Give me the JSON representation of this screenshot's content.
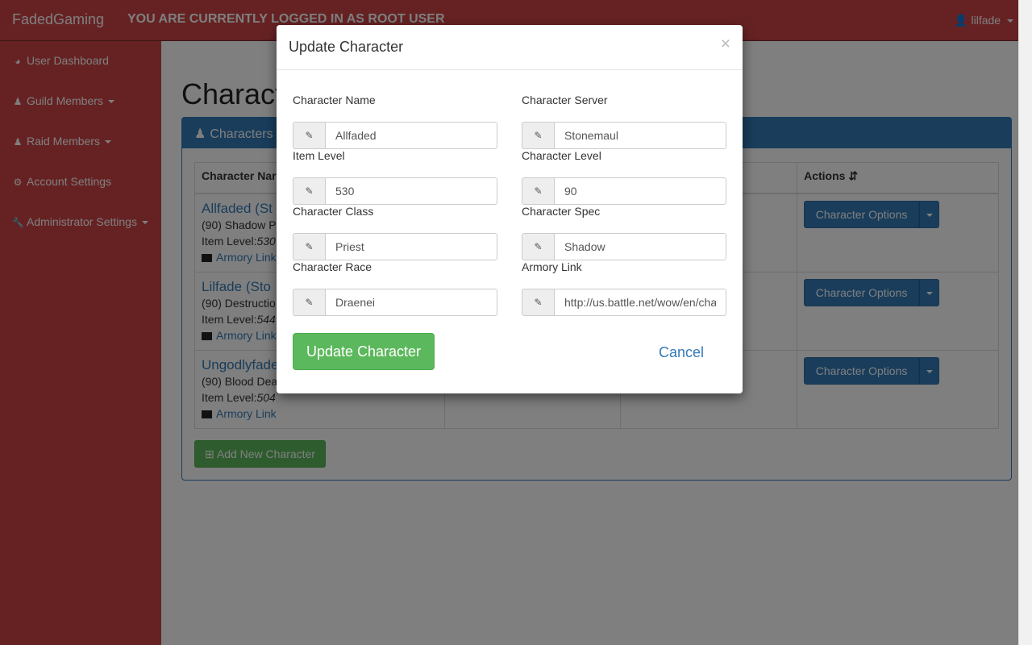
{
  "navbar": {
    "brand": "FadedGaming",
    "notice": "YOU ARE CURRENTLY LOGGED IN AS ROOT USER",
    "user": "lilfade",
    "user_icon": "user-icon"
  },
  "sidebar": {
    "items": [
      {
        "label": "User Dashboard",
        "icon": "dashboard-icon"
      },
      {
        "label": "Guild Members",
        "icon": "users-icon"
      },
      {
        "label": "Raid Members",
        "icon": "users-icon"
      },
      {
        "label": "Account Settings",
        "icon": "gear-icon"
      },
      {
        "label": "Administrator Settings",
        "icon": "wrench-icon"
      }
    ]
  },
  "main": {
    "title": "Charact",
    "panel_title": "Characters",
    "table": {
      "headers": [
        "Character Nar",
        "",
        "",
        "Actions"
      ],
      "rows": [
        {
          "name": "Allfaded (St",
          "spec": "(90) Shadow P",
          "ilvl_label": "Item Level:",
          "ilvl": "530",
          "armory": "Armory Link",
          "action": "Character Options"
        },
        {
          "name": "Lilfade (Sto",
          "spec": "(90) Destructio",
          "ilvl_label": "Item Level:",
          "ilvl": "544",
          "armory": "Armory Link",
          "action": "Character Options"
        },
        {
          "name": "Ungodlyfade",
          "spec": "(90) Blood Dea",
          "ilvl_label": "Item Level:",
          "ilvl": "504",
          "armory": "Armory Link",
          "action": "Character Options"
        }
      ]
    },
    "add_button": "Add New Character"
  },
  "modal": {
    "title": "Update Character",
    "close": "×",
    "fields": {
      "name": {
        "label": "Character Name",
        "value": "Allfaded"
      },
      "server": {
        "label": "Character Server",
        "value": "Stonemaul"
      },
      "ilvl": {
        "label": "Item Level",
        "value": "530"
      },
      "level": {
        "label": "Character Level",
        "value": "90"
      },
      "class": {
        "label": "Character Class",
        "value": "Priest"
      },
      "spec": {
        "label": "Character Spec",
        "value": "Shadow"
      },
      "race": {
        "label": "Character Race",
        "value": "Draenei"
      },
      "armory": {
        "label": "Armory Link",
        "value": "http://us.battle.net/wow/en/character/stonemaul/Allfaded/advanced"
      }
    },
    "update_button": "Update Character",
    "cancel": "Cancel"
  },
  "colors": {
    "brand_red": "#cd4447",
    "primary": "#337ab7",
    "success": "#5cb85c"
  }
}
